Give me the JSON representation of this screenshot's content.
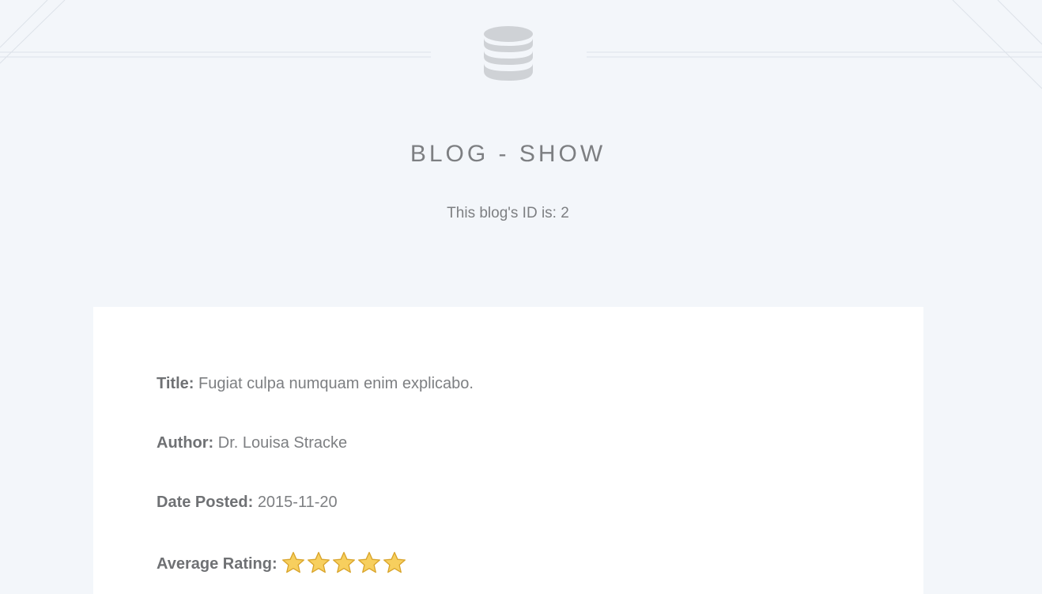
{
  "header": {
    "icon": "database-icon",
    "title": "BLOG - SHOW",
    "subtitle": "This blog's ID is: 2"
  },
  "blog": {
    "title_label": "Title:",
    "title_value": "Fugiat culpa numquam enim explicabo.",
    "author_label": "Author:",
    "author_value": "Dr. Louisa Stracke",
    "date_label": "Date Posted:",
    "date_value": "2015-11-20",
    "rating_label": "Average Rating:",
    "rating_value": 5,
    "rating_max": 5
  },
  "colors": {
    "background": "#f3f6fa",
    "card": "#ffffff",
    "text": "#7d7f82",
    "icon": "#cfd2d6",
    "star_fill": "#f7cf5e",
    "star_stroke": "#d9a42a"
  }
}
